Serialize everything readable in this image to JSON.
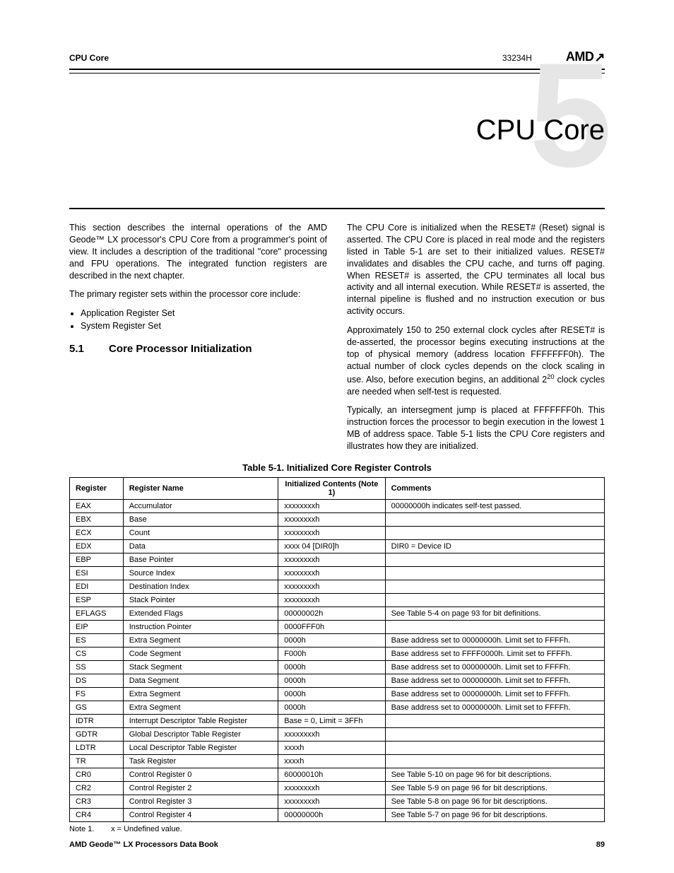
{
  "header": {
    "section": "CPU Core",
    "docnum": "33234H",
    "logo": "AMD"
  },
  "chapter": {
    "number": "5",
    "title": "CPU Core"
  },
  "body": {
    "p1": "This section describes the internal operations of the AMD Geode™ LX processor's CPU Core from a programmer's point of view. It includes a description of the traditional \"core\" processing and FPU operations. The integrated function registers are described in the next chapter.",
    "p2": "The primary register sets within the processor core include:",
    "bullets": [
      "Application Register Set",
      "System Register Set"
    ],
    "sec_num": "5.1",
    "sec_title": "Core Processor Initialization",
    "p3": "The CPU Core is initialized when the RESET# (Reset) signal is asserted. The CPU Core is placed in real mode and the registers listed in Table 5-1 are set to their initialized values. RESET# invalidates and disables the CPU cache, and turns off paging. When RESET# is asserted, the CPU terminates all local bus activity and all internal execution. While RESET# is asserted, the internal pipeline is flushed and no instruction execution or bus activity occurs.",
    "p4a": "Approximately 150 to 250 external clock cycles after RESET# is de-asserted, the processor begins executing instructions at the top of physical memory (address location FFFFFFF0h). The actual number of clock cycles depends on the clock scaling in use. Also, before execution begins, an additional 2",
    "p4sup": "20",
    "p4b": " clock cycles are needed when self-test is requested.",
    "p5": "Typically, an intersegment jump is placed at FFFFFFF0h. This instruction forces the processor to begin execution in the lowest 1 MB of address space. Table 5-1 lists the CPU Core registers and illustrates how they are initialized."
  },
  "table": {
    "title": "Table 5-1.  Initialized Core Register Controls",
    "headers": [
      "Register",
      "Register Name",
      "Initialized Contents (Note 1)",
      "Comments"
    ],
    "rows": [
      [
        "EAX",
        "Accumulator",
        "xxxxxxxxh",
        "00000000h indicates self-test passed."
      ],
      [
        "EBX",
        "Base",
        "xxxxxxxxh",
        ""
      ],
      [
        "ECX",
        "Count",
        "xxxxxxxxh",
        ""
      ],
      [
        "EDX",
        "Data",
        "xxxx 04 [DIR0]h",
        "DIR0 = Device ID"
      ],
      [
        "EBP",
        "Base Pointer",
        "xxxxxxxxh",
        ""
      ],
      [
        "ESI",
        "Source Index",
        "xxxxxxxxh",
        ""
      ],
      [
        "EDI",
        "Destination Index",
        "xxxxxxxxh",
        ""
      ],
      [
        "ESP",
        "Stack Pointer",
        "xxxxxxxxh",
        ""
      ],
      [
        "EFLAGS",
        "Extended Flags",
        "00000002h",
        "See Table 5-4 on page 93 for bit definitions."
      ],
      [
        "EIP",
        "Instruction Pointer",
        "0000FFF0h",
        ""
      ],
      [
        "ES",
        "Extra Segment",
        "0000h",
        "Base address set to 00000000h. Limit set to FFFFh."
      ],
      [
        "CS",
        "Code Segment",
        "F000h",
        "Base address set to FFFF0000h. Limit set to FFFFh."
      ],
      [
        "SS",
        "Stack Segment",
        "0000h",
        "Base address set to 00000000h. Limit set to FFFFh."
      ],
      [
        "DS",
        "Data Segment",
        "0000h",
        "Base address set to 00000000h. Limit set to FFFFh."
      ],
      [
        "FS",
        "Extra Segment",
        "0000h",
        "Base address set to 00000000h. Limit set to FFFFh."
      ],
      [
        "GS",
        "Extra Segment",
        "0000h",
        "Base address set to 00000000h. Limit set to FFFFh."
      ],
      [
        "IDTR",
        "Interrupt Descriptor Table Register",
        "Base = 0, Limit = 3FFh",
        ""
      ],
      [
        "GDTR",
        "Global Descriptor Table Register",
        "xxxxxxxxh",
        ""
      ],
      [
        "LDTR",
        "Local Descriptor Table Register",
        "xxxxh",
        ""
      ],
      [
        "TR",
        "Task Register",
        "xxxxh",
        ""
      ],
      [
        "CR0",
        "Control Register 0",
        "60000010h",
        "See Table 5-10 on page 96 for bit descriptions."
      ],
      [
        "CR2",
        "Control Register 2",
        "xxxxxxxxh",
        "See Table 5-9 on page 96 for bit descriptions."
      ],
      [
        "CR3",
        "Control Register 3",
        "xxxxxxxxh",
        "See Table 5-8 on page 96 for bit descriptions."
      ],
      [
        "CR4",
        "Control Register 4",
        "00000000h",
        "See Table 5-7 on page 96 for bit descriptions."
      ]
    ],
    "note_label": "Note 1.",
    "note_text": "x = Undefined value."
  },
  "footer": {
    "book": "AMD Geode™ LX Processors Data Book",
    "page": "89"
  }
}
